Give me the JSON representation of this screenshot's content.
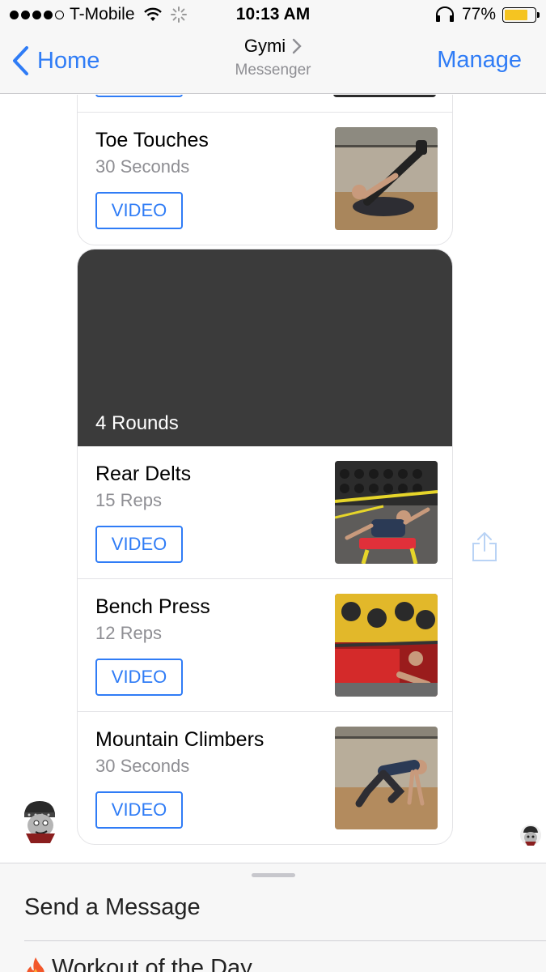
{
  "status_bar": {
    "carrier": "T-Mobile",
    "time": "10:13 AM",
    "battery": "77%",
    "battery_level": 0.77,
    "signal_bars": 4,
    "icons": [
      "wifi-icon",
      "activity-spinner-icon",
      "headphones-icon",
      "battery-icon"
    ]
  },
  "nav": {
    "back_label": "Home",
    "title": "Gymi",
    "subtitle": "Messenger",
    "manage_label": "Manage"
  },
  "card_top": {
    "items": [
      {
        "title": "Toe Touches",
        "detail": "30 Seconds",
        "button": "VIDEO"
      }
    ]
  },
  "card_main": {
    "banner": "4 Rounds",
    "items": [
      {
        "title": "Rear Delts",
        "detail": "15 Reps",
        "button": "VIDEO"
      },
      {
        "title": "Bench Press",
        "detail": "12 Reps",
        "button": "VIDEO"
      },
      {
        "title": "Mountain Climbers",
        "detail": "30 Seconds",
        "button": "VIDEO"
      }
    ]
  },
  "composer": {
    "send_message": "Send a Message",
    "menu_item": "Workout of the Day",
    "menu_item_icon": "fire-icon"
  },
  "colors": {
    "accent": "#2f7cf6",
    "banner": "#3b3b3b",
    "battery": "#f5c421"
  }
}
